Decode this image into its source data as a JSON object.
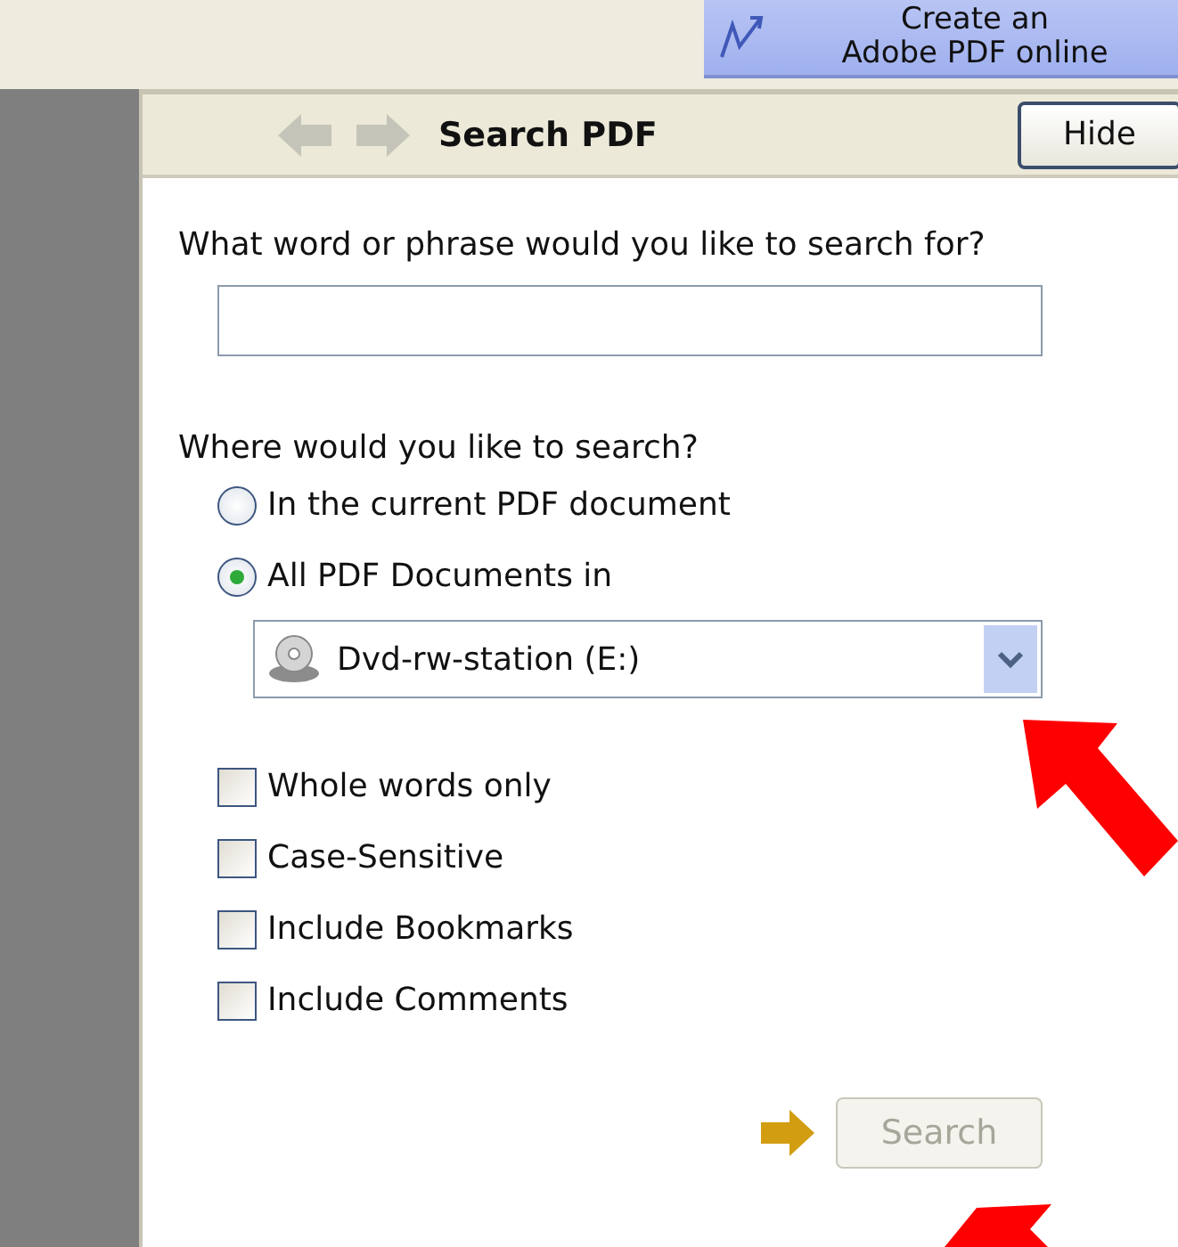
{
  "promo_button": {
    "lines": [
      "Create an",
      "Adobe PDF online"
    ]
  },
  "panel": {
    "title": "Search PDF",
    "hide_button": "Hide"
  },
  "query": {
    "label": "What word or phrase would you like to search for?"
  },
  "scope": {
    "label": "Where would you like to search?",
    "options": [
      {
        "label": "In the current PDF document",
        "selected": false
      },
      {
        "label": "All PDF Documents in",
        "selected": true
      }
    ],
    "location": "Dvd-rw-station (E:)"
  },
  "options": [
    {
      "label": "Whole words only",
      "checked": false
    },
    {
      "label": "Case-Sensitive",
      "checked": false
    },
    {
      "label": "Include Bookmarks",
      "checked": false
    },
    {
      "label": "Include Comments",
      "checked": false
    }
  ],
  "search_button": {
    "label": "Search",
    "disabled": true
  }
}
